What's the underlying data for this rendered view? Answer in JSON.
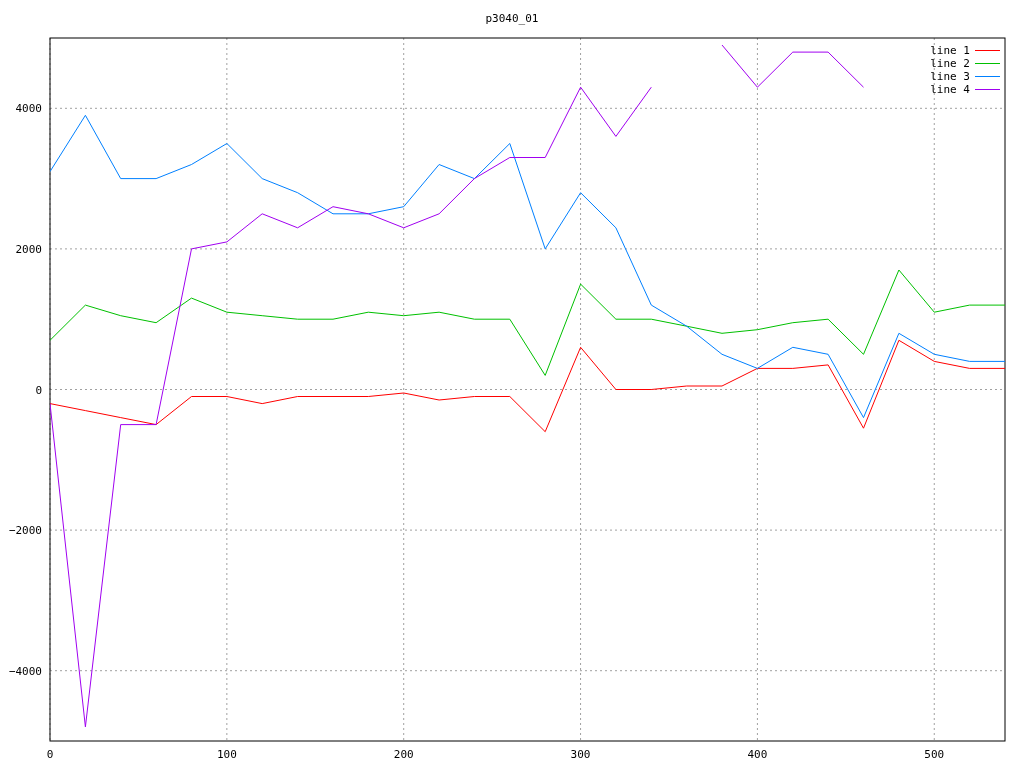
{
  "chart_data": {
    "type": "line",
    "title": "p3040_01",
    "x": [
      0,
      20,
      40,
      60,
      80,
      100,
      120,
      140,
      160,
      180,
      200,
      220,
      240,
      260,
      280,
      300,
      320,
      340,
      360,
      380,
      400,
      420,
      440,
      460,
      480,
      500,
      520,
      540
    ],
    "series": [
      {
        "name": "line 1",
        "color": "#ff0000",
        "values": [
          -200,
          -300,
          -400,
          -500,
          -100,
          -100,
          -200,
          -100,
          -100,
          -100,
          -50,
          -150,
          -100,
          -100,
          -600,
          600,
          0,
          0,
          50,
          50,
          300,
          300,
          350,
          -550,
          700,
          400,
          300,
          300
        ]
      },
      {
        "name": "line 2",
        "color": "#00c000",
        "values": [
          700,
          1200,
          1050,
          950,
          1300,
          1100,
          1050,
          1000,
          1000,
          1100,
          1050,
          1100,
          1000,
          1000,
          200,
          1500,
          1000,
          1000,
          900,
          800,
          850,
          950,
          1000,
          500,
          1700,
          1100,
          1200,
          1200
        ]
      },
      {
        "name": "line 3",
        "color": "#0080ff",
        "values": [
          3100,
          3900,
          3000,
          3000,
          3200,
          3500,
          3000,
          2800,
          2500,
          2500,
          2600,
          3200,
          3000,
          3500,
          2000,
          2800,
          2300,
          1200,
          900,
          500,
          300,
          600,
          500,
          -400,
          800,
          500,
          400,
          400
        ]
      },
      {
        "name": "line 4",
        "color": "#a000f0",
        "values": [
          -200,
          -4800,
          -500,
          -500,
          2000,
          2100,
          2500,
          2300,
          2600,
          2500,
          2300,
          2500,
          3000,
          3300,
          3300,
          4300,
          3600,
          4300,
          null,
          4900,
          4300,
          4800,
          4800,
          4300,
          null,
          null,
          null,
          null
        ]
      }
    ],
    "xlim": [
      0,
      540
    ],
    "ylim": [
      -5000,
      5000
    ],
    "xticks": [
      0,
      100,
      200,
      300,
      400,
      500
    ],
    "yticks": [
      -4000,
      -2000,
      0,
      2000,
      4000
    ],
    "grid": true,
    "legend": true
  }
}
